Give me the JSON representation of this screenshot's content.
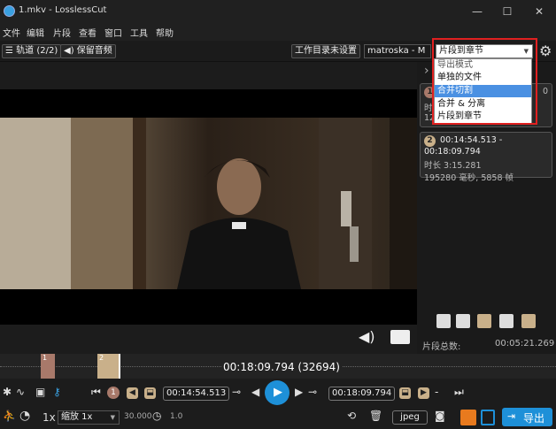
{
  "window": {
    "title": "1.mkv - LosslessCut",
    "minimize": "—",
    "maximize": "☐",
    "close": "✕"
  },
  "menu": [
    "文件",
    "编辑",
    "片段",
    "查看",
    "窗口",
    "工具",
    "帮助"
  ],
  "toolbar": {
    "tracks_label": "轨道 (2/2)",
    "keep_audio_label": "保留音频",
    "workdir_label": "工作目录未设置",
    "format_value": "matroska - M",
    "export_mode_value": "片段到章节"
  },
  "export_mode_dropdown": {
    "options": [
      "导出模式",
      "单独的文件",
      "合并切割",
      "合并 & 分离",
      "片段到章节"
    ],
    "highlighted_index": 2,
    "placeholder_index": 0
  },
  "segments": [
    {
      "number": "1",
      "range_tail": "0",
      "duration_label": "时",
      "frames_label": "12"
    },
    {
      "number": "2",
      "range": "00:14:54.513 - 00:18:09.794",
      "duration": "时长 3:15.281",
      "details": "195280 毫秒, 5858 帧"
    }
  ],
  "segment_total": {
    "label": "片段总数:",
    "value": "00:05:21.269"
  },
  "timeline": {
    "current_time": "00:18:09.794 (32694)",
    "segment_markers": [
      "1",
      "2"
    ]
  },
  "controls": {
    "segment_number": "1",
    "start_time": "00:14:54.513",
    "end_time": "00:18:09.794"
  },
  "playback": {
    "speed_label": "1x",
    "speed_select": "缩放 1x",
    "fps": "30.000",
    "zoom": "1.0",
    "capture_format": "jpeg",
    "export_label": "导出"
  },
  "colors": {
    "segment1": "#a8796a",
    "segment2": "#c9b08a",
    "accent_blue": "#1e90d8",
    "orange": "#e87a1e",
    "highlight": "#4a90e2",
    "red_outline": "#e02020"
  }
}
